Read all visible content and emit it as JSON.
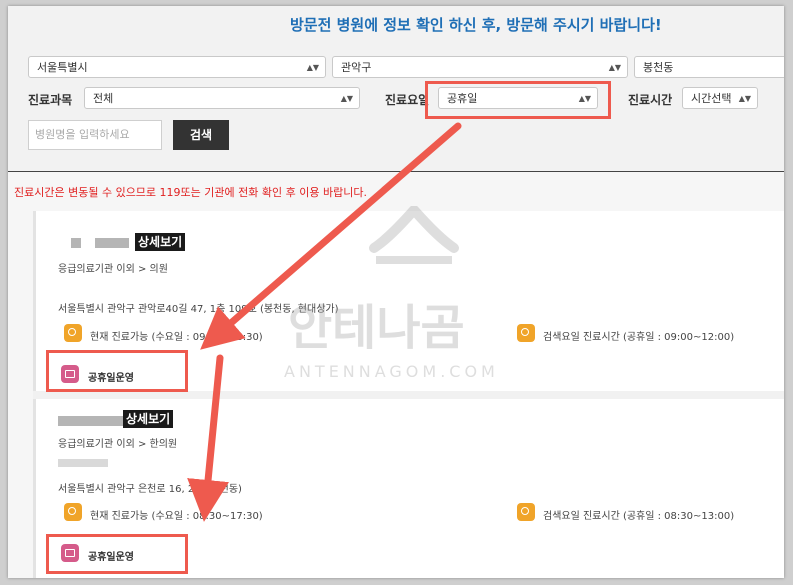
{
  "headline": "방문전 병원에 정보 확인 하신 후, 방문해 주시기 바랍니다!",
  "filters": {
    "city": "서울특별시",
    "district": "관악구",
    "dong": "봉천동",
    "dept_label": "진료과목",
    "dept_value": "전체",
    "day_label": "진료요일",
    "day_value": "공휴일",
    "time_label": "진료시간",
    "time_value": "시간선택",
    "search_placeholder": "병원명을 입력하세요",
    "search_button": "검색"
  },
  "notice": "진료시간은 변동될 수 있으므로 119또는 기관에 전화 확인 후 이용 바랍니다.",
  "hospitals": [
    {
      "detail_label": "상세보기",
      "category": "응급의료기관 이외 > 의원",
      "address": "서울특별시 관악구 관악로40길 47, 1층 109호 (봉천동, 현대상가)",
      "current": "현재 진료가능 (수요일 : 09:00~18:30)",
      "search_day": "검색요일 진료시간 (공휴일 : 09:00~12:00)",
      "badge": "공휴일운영"
    },
    {
      "detail_label": "상세보기",
      "category": "응급의료기관 이외 > 한의원",
      "address": "서울특별시 관악구 은천로 16, 2층 (봉천동)",
      "current": "현재 진료가능 (수요일 : 08:30~17:30)",
      "search_day": "검색요일 진료시간 (공휴일 : 08:30~13:00)",
      "badge": "공휴일운영"
    }
  ],
  "watermark": {
    "logo": "안테나곰",
    "sub": "ANTENNAGOM.COM"
  },
  "colors": {
    "headline": "#1f6fb6",
    "notice": "#e02020",
    "highlight": "#ee5a4e",
    "clock": "#f0a429",
    "calendar": "#d55b8a"
  }
}
